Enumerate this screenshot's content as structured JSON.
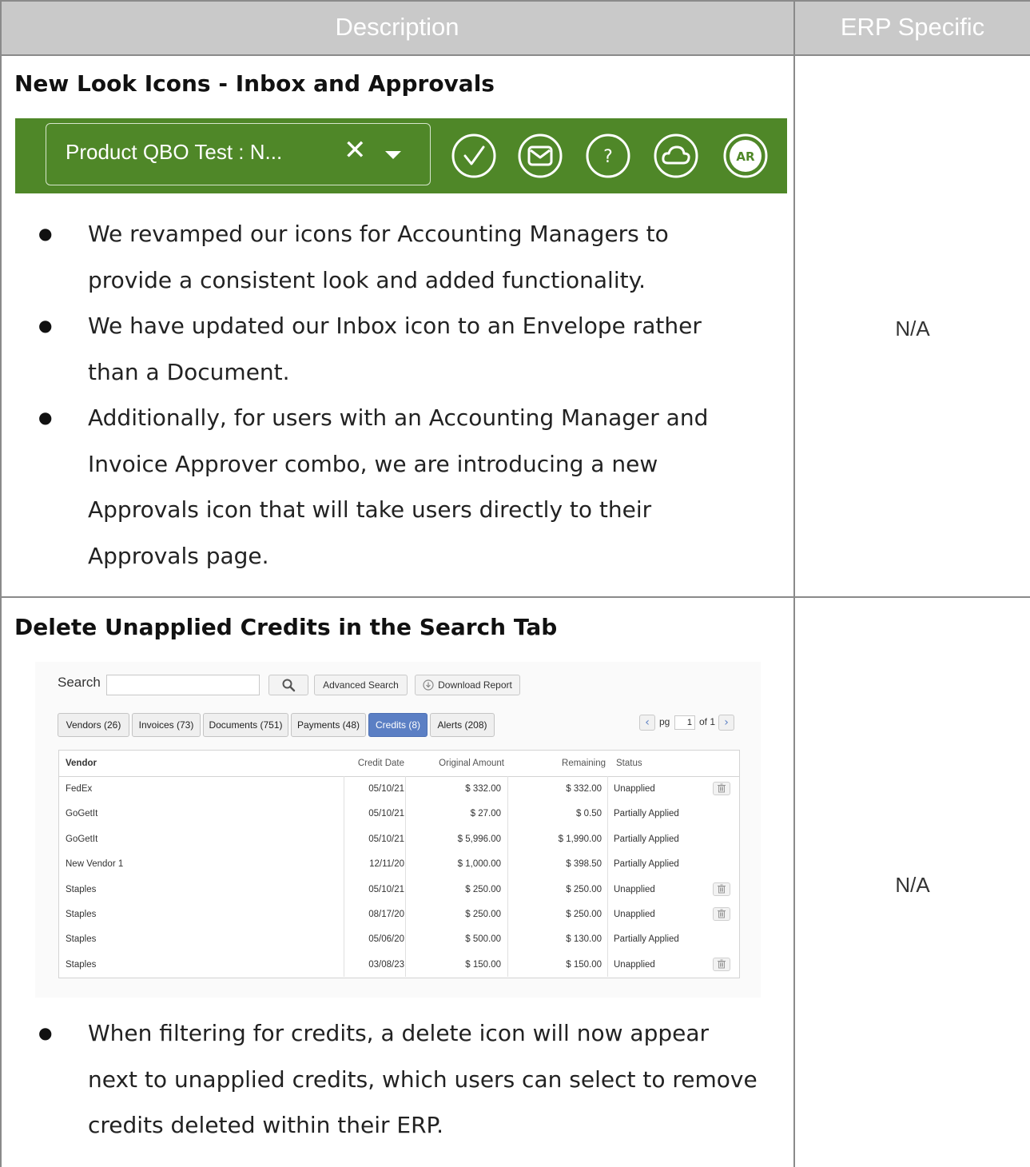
{
  "header": {
    "description": "Description",
    "erp_specific": "ERP Specific"
  },
  "section1": {
    "title": "New Look Icons - Inbox and Approvals",
    "erp": "N/A",
    "toolbar": {
      "company_select": "Product QBO Test : N...",
      "clear_symbol": "✕",
      "icons": [
        "check-circle-icon",
        "envelope-icon",
        "question-icon",
        "cloud-icon",
        "ar-icon"
      ],
      "ar_label": "AR",
      "help_label": "?",
      "bar_color": "#4f8728"
    },
    "bullets": [
      "We revamped our icons for Accounting Managers to provide a consistent look and added functionality.",
      "We have updated our Inbox icon to an Envelope rather than a Document.",
      "Additionally, for users with an Accounting Manager and Invoice Approver combo, we are introducing a new Approvals icon that will take users directly to their Approvals page."
    ]
  },
  "section2": {
    "title": "Delete Unapplied Credits in the Search Tab",
    "erp": "N/A",
    "search": {
      "label": "Search",
      "value": "",
      "advanced_label": "Advanced Search",
      "download_label": "Download Report"
    },
    "tabs": [
      {
        "label": "Vendors  (26)",
        "active": false
      },
      {
        "label": "Invoices  (73)",
        "active": false
      },
      {
        "label": "Documents  (751)",
        "active": false
      },
      {
        "label": "Payments  (48)",
        "active": false
      },
      {
        "label": "Credits  (8)",
        "active": true
      },
      {
        "label": "Alerts  (208)",
        "active": false
      }
    ],
    "pager": {
      "pg_label": "pg",
      "page": "1",
      "of_label": "of 1"
    },
    "columns": {
      "vendor": "Vendor",
      "credit_date": "Credit Date",
      "original_amount": "Original Amount",
      "remaining": "Remaining",
      "status": "Status"
    },
    "rows": [
      {
        "vendor": "FedEx",
        "date": "05/10/21",
        "original": "$ 332.00",
        "remaining": "$ 332.00",
        "status": "Unapplied",
        "delete": true
      },
      {
        "vendor": "GoGetIt",
        "date": "05/10/21",
        "original": "$ 27.00",
        "remaining": "$ 0.50",
        "status": "Partially Applied",
        "delete": false
      },
      {
        "vendor": "GoGetIt",
        "date": "05/10/21",
        "original": "$ 5,996.00",
        "remaining": "$ 1,990.00",
        "status": "Partially Applied",
        "delete": false
      },
      {
        "vendor": "New Vendor 1",
        "date": "12/11/20",
        "original": "$ 1,000.00",
        "remaining": "$ 398.50",
        "status": "Partially Applied",
        "delete": false
      },
      {
        "vendor": "Staples",
        "date": "05/10/21",
        "original": "$ 250.00",
        "remaining": "$ 250.00",
        "status": "Unapplied",
        "delete": true
      },
      {
        "vendor": "Staples",
        "date": "08/17/20",
        "original": "$ 250.00",
        "remaining": "$ 250.00",
        "status": "Unapplied",
        "delete": true
      },
      {
        "vendor": "Staples",
        "date": "05/06/20",
        "original": "$ 500.00",
        "remaining": "$ 130.00",
        "status": "Partially Applied",
        "delete": false
      },
      {
        "vendor": "Staples",
        "date": "03/08/23",
        "original": "$ 150.00",
        "remaining": "$ 150.00",
        "status": "Unapplied",
        "delete": true
      }
    ],
    "bullets": [
      "When filtering for credits, a delete icon will now appear next to unapplied credits, which users can select to remove credits deleted within their ERP."
    ]
  }
}
